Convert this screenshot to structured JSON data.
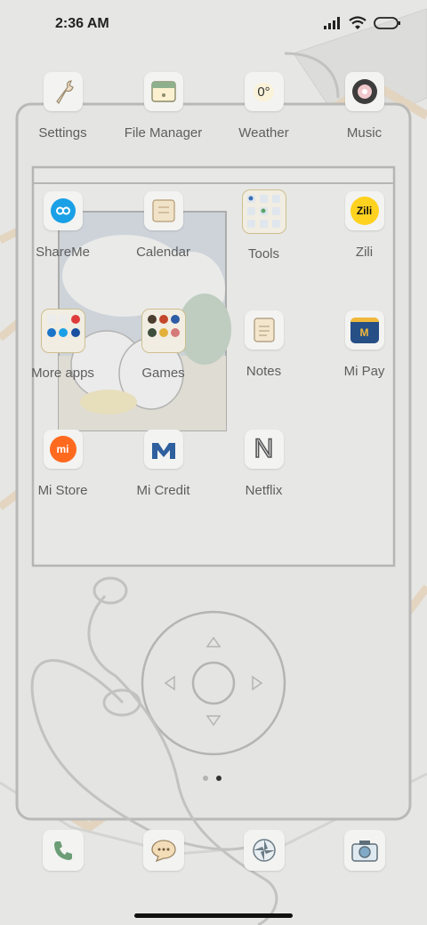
{
  "status_bar": {
    "time": "2:36 AM"
  },
  "top_row": [
    {
      "label": "Settings"
    },
    {
      "label": "File Manager"
    },
    {
      "label": "Weather",
      "icon_text": "0°"
    },
    {
      "label": "Music"
    }
  ],
  "grid": [
    {
      "label": "ShareMe"
    },
    {
      "label": "Calendar"
    },
    {
      "label": "Tools"
    },
    {
      "label": "Zili",
      "icon_text": "Zili"
    },
    {
      "label": "More apps"
    },
    {
      "label": "Games"
    },
    {
      "label": "Notes"
    },
    {
      "label": "Mi Pay",
      "icon_text": "M"
    },
    {
      "label": "Mi Store",
      "icon_text": "mi"
    },
    {
      "label": "Mi Credit"
    },
    {
      "label": "Netflix",
      "icon_text": "N"
    }
  ],
  "dock": [
    {
      "icon": "phone-icon"
    },
    {
      "icon": "messages-icon"
    },
    {
      "icon": "browser-icon"
    },
    {
      "icon": "camera-icon"
    }
  ],
  "pager": {
    "pages": 2,
    "active_index": 1
  },
  "colors": {
    "background": "#e6e6e4",
    "label": "#5e5e5e",
    "accent_blue": "#1aa0e6",
    "mi_orange": "#ff6a1f",
    "zili_yellow": "#ffd21f"
  }
}
